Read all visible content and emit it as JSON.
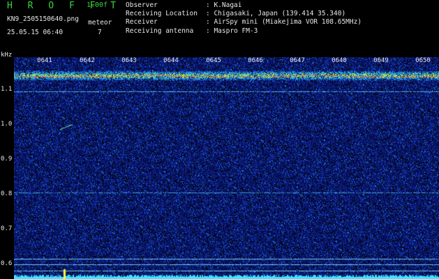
{
  "header": {
    "app_title": "H R O F F T",
    "version": "1.00f",
    "filename": "KN9_2505150640.png",
    "datetime": "25.05.15 06:40",
    "meteor_label": "meteor",
    "meteor_count": "7"
  },
  "station": [
    {
      "key": "Observer",
      "value": ": K.Nagai"
    },
    {
      "key": "Receiving Location",
      "value": ": Chigasaki, Japan (139.414 35.340)"
    },
    {
      "key": "Receiver",
      "value": ": AirSpy mini (Miakejima VOR 108.65MHz)"
    },
    {
      "key": "Receiving antenna",
      "value": ": Maspro FM-3"
    }
  ],
  "axis": {
    "unit": "kHz",
    "y_ticks": [
      "1.1",
      "1.0",
      "0.9",
      "0.8",
      "0.7",
      "0.6"
    ],
    "time_ticks": [
      "0641",
      "0642",
      "0643",
      "0644",
      "0645",
      "0646",
      "0647",
      "0648",
      "0649",
      "0650"
    ]
  },
  "colors": {
    "background": "#000000",
    "title": "#3fd23f",
    "text": "#e8e8e8",
    "carrier_red": "#ff3030",
    "signal_cyan": "#33ddff",
    "noise_blue": "#1530b0"
  }
}
